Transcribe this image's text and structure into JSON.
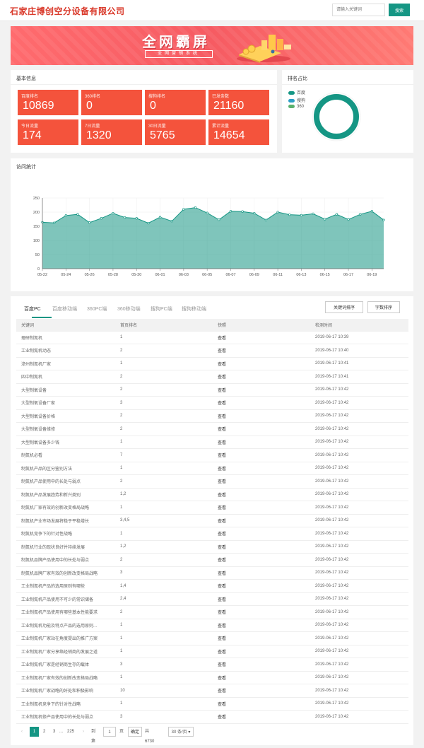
{
  "header": {
    "brand": "石家庄博创空分设备有限公司",
    "search_placeholder": "请输入关键词",
    "search_button": "搜索"
  },
  "banner": {
    "title": "全网霸屏",
    "subtitle": "全网营销系统"
  },
  "basic_info": {
    "title": "基本信息",
    "stats": [
      {
        "label": "百度排名",
        "value": "10869"
      },
      {
        "label": "360排名",
        "value": "0"
      },
      {
        "label": "搜狗排名",
        "value": "0"
      },
      {
        "label": "已发条数",
        "value": "21160"
      },
      {
        "label": "今日流量",
        "value": "174"
      },
      {
        "label": "7日流量",
        "value": "1320"
      },
      {
        "label": "30日流量",
        "value": "5765"
      },
      {
        "label": "累计流量",
        "value": "14654"
      }
    ],
    "accent_color": "#f4533c"
  },
  "rank_share": {
    "title": "排名占比",
    "legend": [
      {
        "name": "百度",
        "color": "#159684"
      },
      {
        "name": "搜狗",
        "color": "#2c9fc7"
      },
      {
        "name": "360",
        "color": "#5ab16e"
      }
    ]
  },
  "visits": {
    "title": "访问统计"
  },
  "chart_data": {
    "type": "area",
    "x": [
      "05-22",
      "05-23",
      "05-24",
      "05-25",
      "05-26",
      "05-27",
      "05-28",
      "05-29",
      "05-30",
      "05-31",
      "06-01",
      "06-02",
      "06-03",
      "06-04",
      "06-05",
      "06-06",
      "06-07",
      "06-08",
      "06-09",
      "06-10",
      "06-11",
      "06-12",
      "06-13",
      "06-14",
      "06-15",
      "06-16",
      "06-17",
      "06-18",
      "06-19",
      "06-20"
    ],
    "xticks": [
      "05-22",
      "05-24",
      "05-26",
      "05-28",
      "05-30",
      "06-01",
      "06-03",
      "06-05",
      "06-07",
      "06-09",
      "06-11",
      "06-13",
      "06-15",
      "06-17",
      "06-19"
    ],
    "values": [
      164,
      162,
      188,
      192,
      163,
      178,
      196,
      181,
      178,
      161,
      182,
      168,
      210,
      216,
      197,
      173,
      203,
      202,
      196,
      172,
      200,
      191,
      189,
      194,
      175,
      192,
      174,
      192,
      203,
      172
    ],
    "yticks": [
      "0",
      "50",
      "100",
      "150",
      "200",
      "250"
    ],
    "ylim": [
      0,
      250
    ],
    "color": "#159684",
    "grid": true
  },
  "keyword_table": {
    "tabs": [
      "百度PC",
      "百度移动端",
      "360PC端",
      "360移动端",
      "搜狗PC端",
      "搜狗移动端"
    ],
    "buttons": [
      "关键词排序",
      "字数排序"
    ],
    "columns": [
      "关键词",
      "首页排名",
      "快照",
      "检测时间"
    ],
    "rows": [
      [
        "理研制氮机",
        "1",
        "查看",
        "2019-06-17 10:39"
      ],
      [
        "工业制氮机动态",
        "2",
        "查看",
        "2019-06-17 10:40"
      ],
      [
        "漳州制氮机厂家",
        "1",
        "查看",
        "2019-06-17 10:41"
      ],
      [
        "四中制氮机",
        "2",
        "查看",
        "2019-06-17 10:41"
      ],
      [
        "大型制氧设备",
        "2",
        "查看",
        "2019-06-17 10:42"
      ],
      [
        "大型制氧设备厂家",
        "3",
        "查看",
        "2019-06-17 10:42"
      ],
      [
        "大型制氧设备价格",
        "2",
        "查看",
        "2019-06-17 10:42"
      ],
      [
        "大型制氧设备维修",
        "2",
        "查看",
        "2019-06-17 10:42"
      ],
      [
        "大型制氧设备多少钱",
        "1",
        "查看",
        "2019-06-17 10:42"
      ],
      [
        "制氮机必看",
        "7",
        "查看",
        "2019-06-17 10:42"
      ],
      [
        "制氮机产品的区分鉴别方法",
        "1",
        "查看",
        "2019-06-17 10:42"
      ],
      [
        "制氮机产品使用中的长处与弱点",
        "2",
        "查看",
        "2019-06-17 10:42"
      ],
      [
        "制氮机产品发展趋势和新兴类别",
        "1,2",
        "查看",
        "2019-06-17 10:42"
      ],
      [
        "制氮机厂家有效的创新改变格局战略",
        "1",
        "查看",
        "2019-06-17 10:42"
      ],
      [
        "制氮机产业市场发展将稳于平稳增长",
        "3,4,5",
        "查看",
        "2019-06-17 10:42"
      ],
      [
        "制氮机竞争下的针对性战略",
        "1",
        "查看",
        "2019-06-17 10:42"
      ],
      [
        "制氮机行业的现状良好并持续发展",
        "1,2",
        "查看",
        "2019-06-17 10:42"
      ],
      [
        "制氮机品牌产品使用中的长处与弱点",
        "2",
        "查看",
        "2019-06-17 10:42"
      ],
      [
        "制氮机品牌厂家有效的创新改变格局战略",
        "3",
        "查看",
        "2019-06-17 10:42"
      ],
      [
        "工业制氮机产品的选用原则有哪些",
        "1,4",
        "查看",
        "2019-06-17 10:42"
      ],
      [
        "工业制氮机产品使用不可少的常识储备",
        "2,4",
        "查看",
        "2019-06-17 10:42"
      ],
      [
        "工业制氮机产品使用有哪些基本性能要求",
        "2",
        "查看",
        "2019-06-17 10:42"
      ],
      [
        "工业制氮机功能及特点产品的选用原则...",
        "1",
        "查看",
        "2019-06-17 10:42"
      ],
      [
        "工业制氮机厂家站在角度提出的推广方案",
        "1",
        "查看",
        "2019-06-17 10:42"
      ],
      [
        "工业制氮机厂家分享络经销商的发展之道",
        "1",
        "查看",
        "2019-06-17 10:42"
      ],
      [
        "工业制氮机厂家是经销商生存的载体",
        "3",
        "查看",
        "2019-06-17 10:42"
      ],
      [
        "工业制氮机厂家有效的创新改变格局战略",
        "1",
        "查看",
        "2019-06-17 10:42"
      ],
      [
        "工业制氮机厂家战略的好处和积极影响",
        "10",
        "查看",
        "2019-06-17 10:42"
      ],
      [
        "工业制氮机竞争下的针对性战略",
        "1",
        "查看",
        "2019-06-17 10:42"
      ],
      [
        "工业制氮机修产品使用中的长处与弱点",
        "3",
        "查看",
        "2019-06-17 10:42"
      ]
    ]
  },
  "pagination": {
    "prev": "‹",
    "pages": [
      "1",
      "2",
      "3"
    ],
    "ellipsis": "...",
    "last": "225",
    "next": "›",
    "goto_label": "到第",
    "goto_value": "1",
    "page_unit": "页",
    "confirm": "确定",
    "total": "共 6730 条",
    "per_page": "30 条/页"
  }
}
